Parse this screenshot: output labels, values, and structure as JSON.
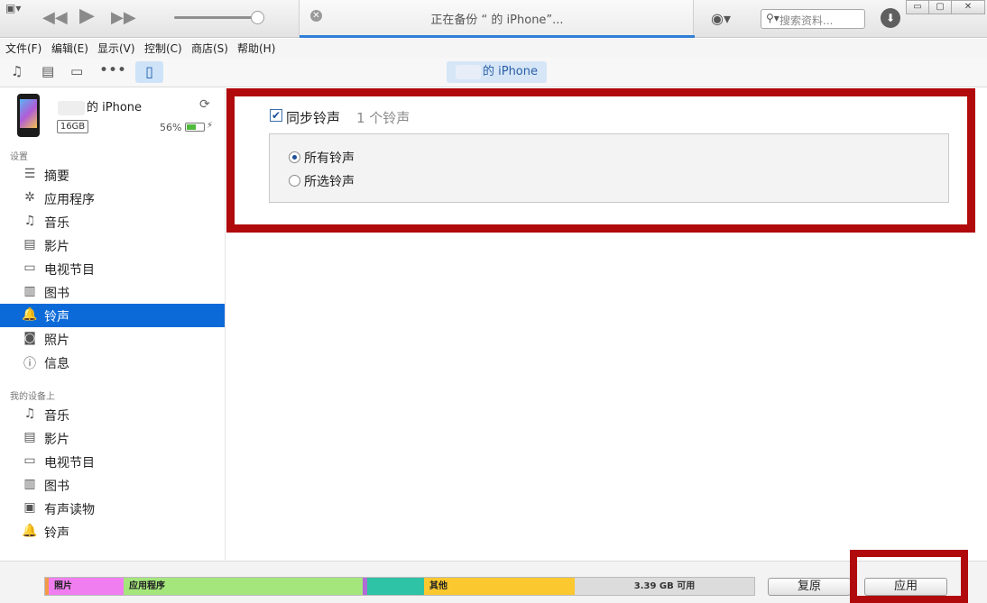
{
  "titlebar": {
    "lcd_text": "正在备份 “      的 iPhone”...",
    "search_placeholder": "搜索资料...",
    "playback": {
      "prev": "◀◀",
      "play": "▶",
      "next": "▶▶"
    }
  },
  "menu": [
    "文件(F)",
    "编辑(E)",
    "显示(V)",
    "控制(C)",
    "商店(S)",
    "帮助(H)"
  ],
  "toolbar": {
    "device_label": "的 iPhone"
  },
  "device": {
    "name": "的 iPhone",
    "capacity": "16GB",
    "battery_percent": "56%",
    "battery_level": 0.56
  },
  "sidebar": {
    "settings_header": "设置",
    "settings_items": [
      {
        "icon": "summary-icon",
        "glyph": "☰",
        "label": "摘要"
      },
      {
        "icon": "apps-icon",
        "glyph": "✲",
        "label": "应用程序"
      },
      {
        "icon": "music-icon",
        "glyph": "♫",
        "label": "音乐"
      },
      {
        "icon": "film-icon",
        "glyph": "▤",
        "label": "影片"
      },
      {
        "icon": "tv-icon",
        "glyph": "▭",
        "label": "电视节目"
      },
      {
        "icon": "book-icon",
        "glyph": "▥",
        "label": "图书"
      },
      {
        "icon": "bell-icon",
        "glyph": "🔔",
        "label": "铃声"
      },
      {
        "icon": "camera-icon",
        "glyph": "◙",
        "label": "照片"
      },
      {
        "icon": "info-icon",
        "glyph": "ⓘ",
        "label": "信息"
      }
    ],
    "device_header": "我的设备上",
    "device_items": [
      {
        "icon": "music-icon",
        "glyph": "♫",
        "label": "音乐"
      },
      {
        "icon": "film-icon",
        "glyph": "▤",
        "label": "影片"
      },
      {
        "icon": "tv-icon",
        "glyph": "▭",
        "label": "电视节目"
      },
      {
        "icon": "book-icon",
        "glyph": "▥",
        "label": "图书"
      },
      {
        "icon": "audiobook-icon",
        "glyph": "▣",
        "label": "有声读物"
      },
      {
        "icon": "bell-icon",
        "glyph": "🔔",
        "label": "铃声"
      }
    ],
    "selected": "铃声"
  },
  "main": {
    "sync_checked": true,
    "sync_label": "同步铃声",
    "sync_count": "1 个铃声",
    "options": [
      {
        "label": "所有铃声",
        "selected": true
      },
      {
        "label": "所选铃声",
        "selected": false
      }
    ]
  },
  "storage": {
    "segments": [
      {
        "label": "照片",
        "color": "#f07ef0",
        "fraction": 0.106
      },
      {
        "label": "应用程序",
        "color": "#a4e67c",
        "fraction": 0.337
      },
      {
        "label": "",
        "color": "#b16ad6",
        "fraction": 0.006
      },
      {
        "label": "",
        "color": "#2ec2a6",
        "fraction": 0.08
      },
      {
        "label": "其他",
        "color": "#fbc82f",
        "fraction": 0.213
      }
    ],
    "free_label": "3.39 GB 可用"
  },
  "buttons": {
    "restore": "复原",
    "apply": "应用"
  },
  "colors": {
    "accent": "#0b6ad8",
    "highlight": "#b10a0d"
  }
}
